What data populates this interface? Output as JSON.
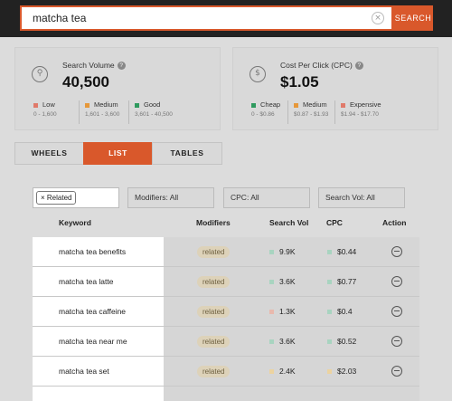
{
  "search": {
    "query": "matcha tea",
    "button_label": "SEARCH",
    "clear_icon": "×"
  },
  "volume_card": {
    "icon": "magnifier-icon",
    "label": "Search Volume",
    "value": "40,500",
    "legend": [
      {
        "label": "Low",
        "range": "0 - 1,600",
        "color": "#e07a6a"
      },
      {
        "label": "Medium",
        "range": "1,601 - 3,600",
        "color": "#e6983a"
      },
      {
        "label": "Good",
        "range": "3,601 - 40,500",
        "color": "#2f9a5e"
      }
    ]
  },
  "cpc_card": {
    "icon": "dollar-icon",
    "label": "Cost Per Click (CPC)",
    "value": "$1.05",
    "legend": [
      {
        "label": "Cheap",
        "range": "0 - $0.86",
        "color": "#2f9a5e"
      },
      {
        "label": "Medium",
        "range": "$0.87 - $1.93",
        "color": "#e6983a"
      },
      {
        "label": "Expensive",
        "range": "$1.94 - $17.70",
        "color": "#e07a6a"
      }
    ]
  },
  "tabs": [
    {
      "label": "WHEELS",
      "active": false
    },
    {
      "label": "LIST",
      "active": true
    },
    {
      "label": "TABLES",
      "active": false
    }
  ],
  "filters": {
    "chip": "Related",
    "chip_remove": "×",
    "modifiers": "Modifiers: All",
    "cpc": "CPC: All",
    "search_vol": "Search Vol: All"
  },
  "table": {
    "headers": {
      "keyword": "Keyword",
      "modifiers": "Modifiers",
      "search_vol": "Search Vol",
      "cpc": "CPC",
      "action": "Action"
    },
    "rows": [
      {
        "keyword": "matcha tea benefits",
        "modifier": "related",
        "vol": "9.9K",
        "vol_color": "#a8d4c0",
        "cpc": "$0.44",
        "cpc_color": "#a8d4c0"
      },
      {
        "keyword": "matcha tea latte",
        "modifier": "related",
        "vol": "3.6K",
        "vol_color": "#a8d4c0",
        "cpc": "$0.77",
        "cpc_color": "#a8d4c0"
      },
      {
        "keyword": "matcha tea caffeine",
        "modifier": "related",
        "vol": "1.3K",
        "vol_color": "#e8b9ad",
        "cpc": "$0.4",
        "cpc_color": "#a8d4c0"
      },
      {
        "keyword": "matcha tea near me",
        "modifier": "related",
        "vol": "3.6K",
        "vol_color": "#a8d4c0",
        "cpc": "$0.52",
        "cpc_color": "#a8d4c0"
      },
      {
        "keyword": "matcha tea set",
        "modifier": "related",
        "vol": "2.4K",
        "vol_color": "#ecd3a0",
        "cpc": "$2.03",
        "cpc_color": "#ecd3a0"
      }
    ]
  }
}
